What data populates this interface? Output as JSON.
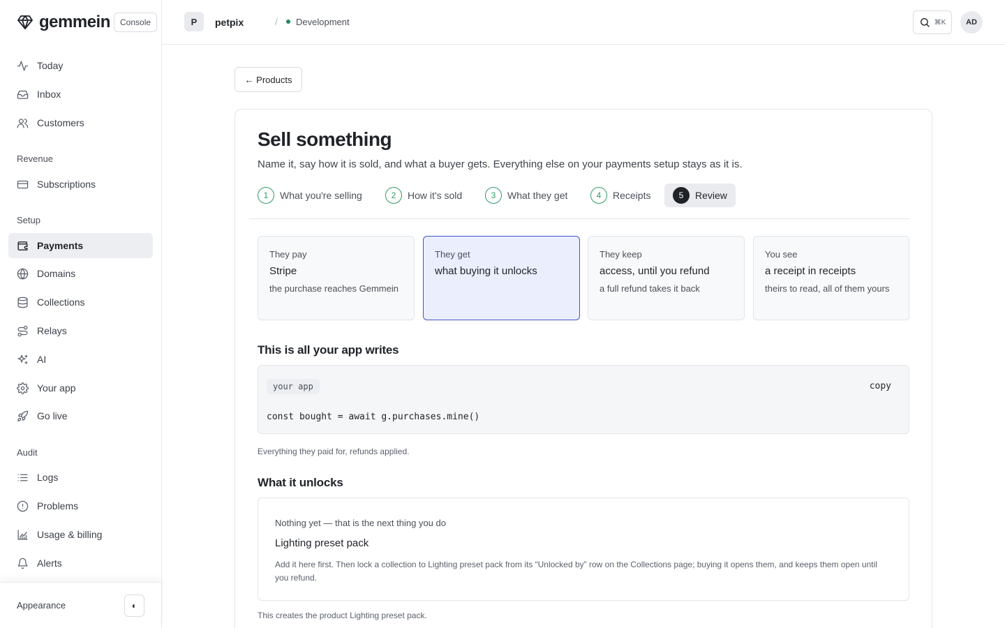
{
  "brand": {
    "name": "gemmein",
    "badge": "Console"
  },
  "nav": {
    "top": [
      {
        "label": "Today",
        "icon": "activity-icon"
      },
      {
        "label": "Inbox",
        "icon": "inbox-icon"
      },
      {
        "label": "Customers",
        "icon": "users-icon"
      }
    ],
    "sections": [
      {
        "title": "Revenue",
        "items": [
          {
            "label": "Subscriptions",
            "icon": "credit-card-icon"
          }
        ]
      },
      {
        "title": "Setup",
        "items": [
          {
            "label": "Payments",
            "icon": "wallet-icon",
            "active": true
          },
          {
            "label": "Domains",
            "icon": "globe-icon"
          },
          {
            "label": "Collections",
            "icon": "database-icon"
          },
          {
            "label": "Relays",
            "icon": "route-icon"
          },
          {
            "label": "AI",
            "icon": "sparkles-icon"
          },
          {
            "label": "Your app",
            "icon": "settings-icon"
          },
          {
            "label": "Go live",
            "icon": "rocket-icon"
          }
        ]
      },
      {
        "title": "Audit",
        "items": [
          {
            "label": "Logs",
            "icon": "list-icon"
          },
          {
            "label": "Problems",
            "icon": "alert-circle-icon"
          },
          {
            "label": "Usage & billing",
            "icon": "bar-chart-icon"
          },
          {
            "label": "Alerts",
            "icon": "bell-icon"
          }
        ]
      }
    ],
    "footer": {
      "label": "Appearance",
      "toggle_icon": "◐"
    }
  },
  "header": {
    "project_initial": "P",
    "project_name": "petpix",
    "separator": "/",
    "environment": "Development",
    "environment_color": "#1f8a5b",
    "search_shortcut": "⌘K",
    "user_initials": "AD"
  },
  "main": {
    "back_label": "← Products",
    "title": "Sell something",
    "subtitle": "Name it, say how it is sold, and what a buyer gets. Everything else on your payments setup stays as it is.",
    "steps": [
      {
        "num": "1",
        "label": "What you're selling"
      },
      {
        "num": "2",
        "label": "How it's sold"
      },
      {
        "num": "3",
        "label": "What they get"
      },
      {
        "num": "4",
        "label": "Receipts"
      },
      {
        "num": "5",
        "label": "Review",
        "current": true
      }
    ],
    "summary": [
      {
        "key": "They pay",
        "value": "Stripe",
        "desc": "the purchase reaches Gemmein"
      },
      {
        "key": "They get",
        "value": "what buying it unlocks",
        "desc": "",
        "selected": true
      },
      {
        "key": "They keep",
        "value": "access, until you refund",
        "desc": "a full refund takes it back"
      },
      {
        "key": "You see",
        "value": "a receipt in receipts",
        "desc": "theirs to read, all of them yours"
      }
    ],
    "code_section": {
      "heading": "This is all your app writes",
      "tag": "your app",
      "copy_label": "copy",
      "code": "const bought = await g.purchases.mine()",
      "note": "Everything they paid for, refunds applied."
    },
    "unlock_section": {
      "heading": "What it unlocks",
      "status": "Nothing yet — that is the next thing you do",
      "product": "Lighting preset pack",
      "description": "Add it here first. Then lock a collection to Lighting preset pack from its “Unlocked by” row on the Collections page; buying it opens them, and keeps them open until you refund.",
      "creates_note": "This creates the product Lighting preset pack."
    }
  }
}
